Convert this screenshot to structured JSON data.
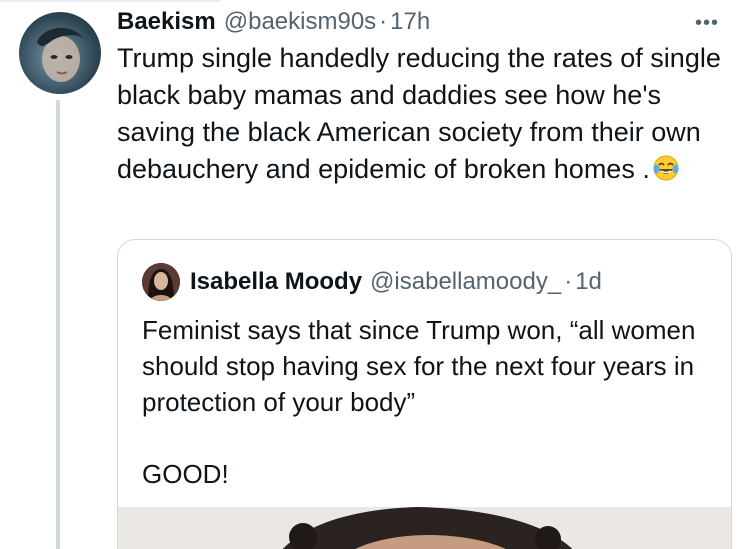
{
  "tweet": {
    "author_name": "Baekism",
    "author_handle": "@baekism90s",
    "separator": "·",
    "time": "17h",
    "text": "Trump single handedly reducing the rates of single black baby mamas and daddies see how he's saving the black American society from their own debauchery and epidemic of broken homes .",
    "emoji": "face-with-tears-of-joy",
    "more_icon": "more-horizontal-icon",
    "more_label": "•••"
  },
  "quote": {
    "author_name": "Isabella Moody",
    "author_handle": "@isabellamoody_",
    "separator": "·",
    "time": "1d",
    "text_line": "Feminist says that since Trump won, “all women should stop having sex for the next four years in protection of your body”",
    "text_emphasis": "GOOD!"
  },
  "colors": {
    "primary_text": "#0f1419",
    "secondary_text": "#536471",
    "border": "#cfd9de",
    "thread_line": "#cfd9de"
  }
}
